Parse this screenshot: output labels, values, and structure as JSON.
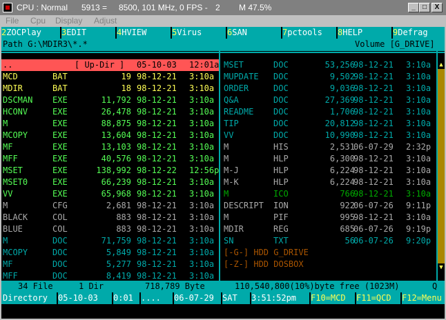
{
  "window": {
    "title": "CPU : Normal",
    "stat1": "5913 =",
    "stat2": "8500, 101 MHz, 0 FPS -",
    "stat3": "2",
    "stat4": "M 47.5%",
    "btn_min": "_",
    "btn_max": "□",
    "btn_close": "X"
  },
  "menu": [
    "File",
    "Cpu",
    "Display",
    "Adjust"
  ],
  "fkeys": [
    {
      "num": "2",
      "label": "ZOCPlay"
    },
    {
      "num": "3",
      "label": "EDIT"
    },
    {
      "num": "4",
      "label": "HVIEW"
    },
    {
      "num": "5",
      "label": "Virus"
    },
    {
      "num": "6",
      "label": "SAN"
    },
    {
      "num": "7",
      "label": "pctools"
    },
    {
      "num": "8",
      "label": "HELP"
    },
    {
      "num": "9",
      "label": "Defrag"
    }
  ],
  "pathbar": {
    "path": "Path G:\\MDIR3\\*.*",
    "volume": "Volume [G_DRIVE]"
  },
  "left_files": [
    {
      "name": "..",
      "ext": "[ Up-Dir ]",
      "size": "",
      "date": "05-10-03",
      "time": "12:01a",
      "color": "#000000",
      "updir": true
    },
    {
      "name": "MCD",
      "ext": "BAT",
      "size": "19",
      "date": "98-12-21",
      "time": "3:10a",
      "color": "#ffff55"
    },
    {
      "name": "MDIR",
      "ext": "BAT",
      "size": "18",
      "date": "98-12-21",
      "time": "3:10a",
      "color": "#ffff55"
    },
    {
      "name": "DSCMAN",
      "ext": "EXE",
      "size": "11,792",
      "date": "98-12-21",
      "time": "3:10a",
      "color": "#55ff55"
    },
    {
      "name": "HCONV",
      "ext": "EXE",
      "size": "26,478",
      "date": "98-12-21",
      "time": "3:10a",
      "color": "#55ff55"
    },
    {
      "name": "M",
      "ext": "EXE",
      "size": "88,875",
      "date": "98-12-21",
      "time": "3:10a",
      "color": "#55ff55"
    },
    {
      "name": "MCOPY",
      "ext": "EXE",
      "size": "13,604",
      "date": "98-12-21",
      "time": "3:10a",
      "color": "#55ff55"
    },
    {
      "name": "MF",
      "ext": "EXE",
      "size": "13,103",
      "date": "98-12-21",
      "time": "3:10a",
      "color": "#55ff55"
    },
    {
      "name": "MFF",
      "ext": "EXE",
      "size": "40,576",
      "date": "98-12-21",
      "time": "3:10a",
      "color": "#55ff55"
    },
    {
      "name": "MSET",
      "ext": "EXE",
      "size": "138,992",
      "date": "98-12-22",
      "time": "12:56p",
      "color": "#55ff55"
    },
    {
      "name": "MSET0",
      "ext": "EXE",
      "size": "66,239",
      "date": "98-12-21",
      "time": "3:10a",
      "color": "#55ff55"
    },
    {
      "name": "VV",
      "ext": "EXE",
      "size": "65,968",
      "date": "98-12-21",
      "time": "3:10a",
      "color": "#55ff55"
    },
    {
      "name": "M",
      "ext": "CFG",
      "size": "2,681",
      "date": "98-12-21",
      "time": "3:10a",
      "color": "#aaaaaa"
    },
    {
      "name": "BLACK",
      "ext": "COL",
      "size": "883",
      "date": "98-12-21",
      "time": "3:10a",
      "color": "#aaaaaa"
    },
    {
      "name": "BLUE",
      "ext": "COL",
      "size": "883",
      "date": "98-12-21",
      "time": "3:10a",
      "color": "#aaaaaa"
    },
    {
      "name": "M",
      "ext": "DOC",
      "size": "71,759",
      "date": "98-12-21",
      "time": "3:10a",
      "color": "#00aaaa"
    },
    {
      "name": "MCOPY",
      "ext": "DOC",
      "size": "5,849",
      "date": "98-12-21",
      "time": "3:10a",
      "color": "#00aaaa"
    },
    {
      "name": "MF",
      "ext": "DOC",
      "size": "5,277",
      "date": "98-12-21",
      "time": "3:10a",
      "color": "#00aaaa"
    },
    {
      "name": "MFF",
      "ext": "DOC",
      "size": "8,419",
      "date": "98-12-21",
      "time": "3:10a",
      "color": "#00aaaa"
    }
  ],
  "right_files": [
    {
      "name": "MSET",
      "ext": "DOC",
      "size": "53,256",
      "date": "98-12-21",
      "time": "3:10a",
      "color": "#00aaaa"
    },
    {
      "name": "MUPDATE",
      "ext": "DOC",
      "size": "9,502",
      "date": "98-12-21",
      "time": "3:10a",
      "color": "#00aaaa"
    },
    {
      "name": "ORDER",
      "ext": "DOC",
      "size": "9,036",
      "date": "98-12-21",
      "time": "3:10a",
      "color": "#00aaaa"
    },
    {
      "name": "Q&A",
      "ext": "DOC",
      "size": "27,369",
      "date": "98-12-21",
      "time": "3:10a",
      "color": "#00aaaa"
    },
    {
      "name": "README",
      "ext": "DOC",
      "size": "1,706",
      "date": "98-12-21",
      "time": "3:10a",
      "color": "#00aaaa"
    },
    {
      "name": "TIP",
      "ext": "DOC",
      "size": "20,812",
      "date": "98-12-21",
      "time": "3:10a",
      "color": "#00aaaa"
    },
    {
      "name": "VV",
      "ext": "DOC",
      "size": "10,990",
      "date": "98-12-21",
      "time": "3:10a",
      "color": "#00aaaa"
    },
    {
      "name": "M",
      "ext": "HIS",
      "size": "2,531",
      "date": "06-07-29",
      "time": "2:32p",
      "color": "#aaaaaa"
    },
    {
      "name": "M",
      "ext": "HLP",
      "size": "6,300",
      "date": "98-12-21",
      "time": "3:10a",
      "color": "#aaaaaa"
    },
    {
      "name": "M-J",
      "ext": "HLP",
      "size": "6,224",
      "date": "98-12-21",
      "time": "3:10a",
      "color": "#aaaaaa"
    },
    {
      "name": "M-K",
      "ext": "HLP",
      "size": "6,224",
      "date": "98-12-21",
      "time": "3:10a",
      "color": "#aaaaaa"
    },
    {
      "name": "M",
      "ext": "ICO",
      "size": "766",
      "date": "98-12-21",
      "time": "3:10a",
      "color": "#00aa00"
    },
    {
      "name": "DESCRIPT",
      "ext": "ION",
      "size": "922",
      "date": "06-07-26",
      "time": "9:11p",
      "color": "#aaaaaa"
    },
    {
      "name": "M",
      "ext": "PIF",
      "size": "995",
      "date": "98-12-21",
      "time": "3:10a",
      "color": "#aaaaaa"
    },
    {
      "name": "MDIR",
      "ext": "REG",
      "size": "685",
      "date": "06-07-26",
      "time": "9:19p",
      "color": "#aaaaaa"
    },
    {
      "name": "SN",
      "ext": "TXT",
      "size": "56",
      "date": "06-07-26",
      "time": "9:20p",
      "color": "#00aaaa"
    },
    {
      "name": "[-G-] HDD G_DRIVE",
      "ext": "",
      "size": "",
      "date": "",
      "time": "",
      "color": "#aa5500"
    },
    {
      "name": "[-Z-] HDD DOSBOX",
      "ext": "",
      "size": "",
      "date": "",
      "time": "",
      "color": "#aa5500"
    }
  ],
  "scroll": {
    "up": "▲",
    "down": "▼"
  },
  "status": {
    "files": "34 File",
    "dirs": "1 Dir",
    "bytes": "718,789 Byte",
    "free": "110,540,800(10%)byte free (1023M)",
    "q": "Q"
  },
  "bottom": [
    {
      "label": "Directory",
      "hl": false
    },
    {
      "label": "05-10-03",
      "hl": false
    },
    {
      "label": "0:01",
      "hl": false
    },
    {
      "label": "....",
      "hl": false
    },
    {
      "label": "06-07-29",
      "hl": false
    },
    {
      "label": "SAT",
      "hl": false
    },
    {
      "label": "3:51:52pm",
      "hl": false
    },
    {
      "label": "F10=MCD",
      "hl": true
    },
    {
      "label": "F11=QCD",
      "hl": true
    },
    {
      "label": "F12=Menu",
      "hl": true
    }
  ]
}
